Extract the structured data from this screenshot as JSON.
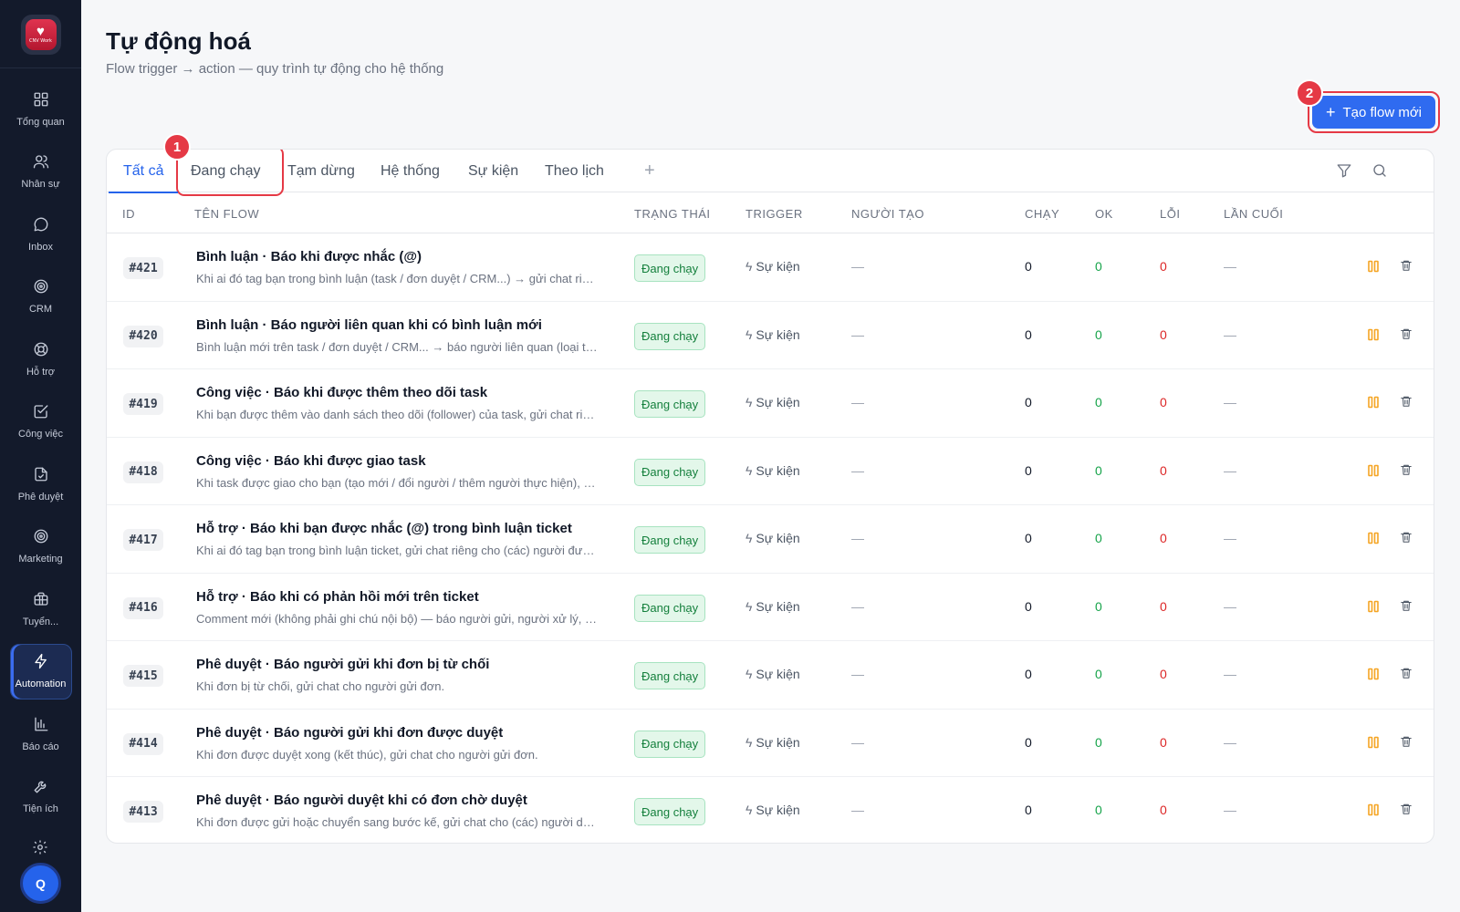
{
  "sidebar": {
    "logo_text": "CNV Work",
    "items": [
      {
        "label": "Tổng quan",
        "icon": "grid-icon"
      },
      {
        "label": "Nhân sự",
        "icon": "users-icon"
      },
      {
        "label": "Inbox",
        "icon": "chat-icon"
      },
      {
        "label": "CRM",
        "icon": "target-icon"
      },
      {
        "label": "Hỗ trợ",
        "icon": "lifebuoy-icon"
      },
      {
        "label": "Công việc",
        "icon": "checkbox-icon"
      },
      {
        "label": "Phê duyệt",
        "icon": "document-icon"
      },
      {
        "label": "Marketing",
        "icon": "target-icon"
      },
      {
        "label": "Tuyển...",
        "icon": "briefcase-icon"
      },
      {
        "label": "Automation",
        "icon": "bolt-icon",
        "active": true
      },
      {
        "label": "Báo cáo",
        "icon": "bar-chart-icon"
      },
      {
        "label": "Tiện ích",
        "icon": "wrench-icon"
      }
    ],
    "avatar_initial": "Q"
  },
  "header": {
    "title": "Tự động hoá",
    "subtitle": "Flow trigger → action — quy trình tự động cho hệ thống",
    "new_flow_label": "Tạo flow mới",
    "annotation_new": "2",
    "annotation_tab": "1"
  },
  "tabs": [
    {
      "label": "Tất cả",
      "active": true
    },
    {
      "label": "Đang chạy"
    },
    {
      "label": "Tạm dừng"
    },
    {
      "label": "Hệ thống"
    },
    {
      "label": "Sự kiện"
    },
    {
      "label": "Theo lịch"
    }
  ],
  "tab_add": "+",
  "columns": {
    "id": "ID",
    "name": "TÊN FLOW",
    "status": "TRẠNG THÁI",
    "trigger": "TRIGGER",
    "creator": "NGƯỜI TẠO",
    "run": "CHẠY",
    "ok": "OK",
    "error": "LỖI",
    "last": "LẦN CUỐI"
  },
  "rows": [
    {
      "id": "#421",
      "name": "Bình luận · Báo khi được nhắc (@)",
      "desc": "Khi ai đó tag bạn trong bình luận (task / đơn duyệt / CRM...) → gửi chat riêng cho người được nhắc.",
      "status": "Đang chạy",
      "trigger": "Sự kiện",
      "creator": "—",
      "run": "0",
      "ok": "0",
      "error": "0",
      "last": "—"
    },
    {
      "id": "#420",
      "name": "Bình luận · Báo người liên quan khi có bình luận mới",
      "desc": "Bình luận mới trên task / đơn duyệt / CRM... → báo người liên quan (loại trừ người bình luận).",
      "status": "Đang chạy",
      "trigger": "Sự kiện",
      "creator": "—",
      "run": "0",
      "ok": "0",
      "error": "0",
      "last": "—"
    },
    {
      "id": "#419",
      "name": "Công việc · Báo khi được thêm theo dõi task",
      "desc": "Khi bạn được thêm vào danh sách theo dõi (follower) của task, gửi chat riêng cho bạn.",
      "status": "Đang chạy",
      "trigger": "Sự kiện",
      "creator": "—",
      "run": "0",
      "ok": "0",
      "error": "0",
      "last": "—"
    },
    {
      "id": "#418",
      "name": "Công việc · Báo khi được giao task",
      "desc": "Khi task được giao cho bạn (tạo mới / đổi người / thêm người thực hiện), gửi chat riêng.",
      "status": "Đang chạy",
      "trigger": "Sự kiện",
      "creator": "—",
      "run": "0",
      "ok": "0",
      "error": "0",
      "last": "—"
    },
    {
      "id": "#417",
      "name": "Hỗ trợ · Báo khi bạn được nhắc (@) trong bình luận ticket",
      "desc": "Khi ai đó tag bạn trong bình luận ticket, gửi chat riêng cho (các) người được nhắc.",
      "status": "Đang chạy",
      "trigger": "Sự kiện",
      "creator": "—",
      "run": "0",
      "ok": "0",
      "error": "0",
      "last": "—"
    },
    {
      "id": "#416",
      "name": "Hỗ trợ · Báo khi có phản hồi mới trên ticket",
      "desc": "Comment mới (không phải ghi chú nội bộ) — báo người gửi, người xử lý, người theo dõi.",
      "status": "Đang chạy",
      "trigger": "Sự kiện",
      "creator": "—",
      "run": "0",
      "ok": "0",
      "error": "0",
      "last": "—"
    },
    {
      "id": "#415",
      "name": "Phê duyệt · Báo người gửi khi đơn bị từ chối",
      "desc": "Khi đơn bị từ chối, gửi chat cho người gửi đơn.",
      "status": "Đang chạy",
      "trigger": "Sự kiện",
      "creator": "—",
      "run": "0",
      "ok": "0",
      "error": "0",
      "last": "—"
    },
    {
      "id": "#414",
      "name": "Phê duyệt · Báo người gửi khi đơn được duyệt",
      "desc": "Khi đơn được duyệt xong (kết thúc), gửi chat cho người gửi đơn.",
      "status": "Đang chạy",
      "trigger": "Sự kiện",
      "creator": "—",
      "run": "0",
      "ok": "0",
      "error": "0",
      "last": "—"
    },
    {
      "id": "#413",
      "name": "Phê duyệt · Báo người duyệt khi có đơn chờ duyệt",
      "desc": "Khi đơn được gửi hoặc chuyển sang bước kế, gửi chat cho (các) người duyệt.",
      "status": "Đang chạy",
      "trigger": "Sự kiện",
      "creator": "—",
      "run": "0",
      "ok": "0",
      "error": "0",
      "last": "—"
    }
  ],
  "colors": {
    "accent": "#2f6bf0",
    "annotation": "#e53945",
    "sidebar": "#131a2b",
    "status_green": "#15803d",
    "pause_orange": "#f5a524"
  }
}
